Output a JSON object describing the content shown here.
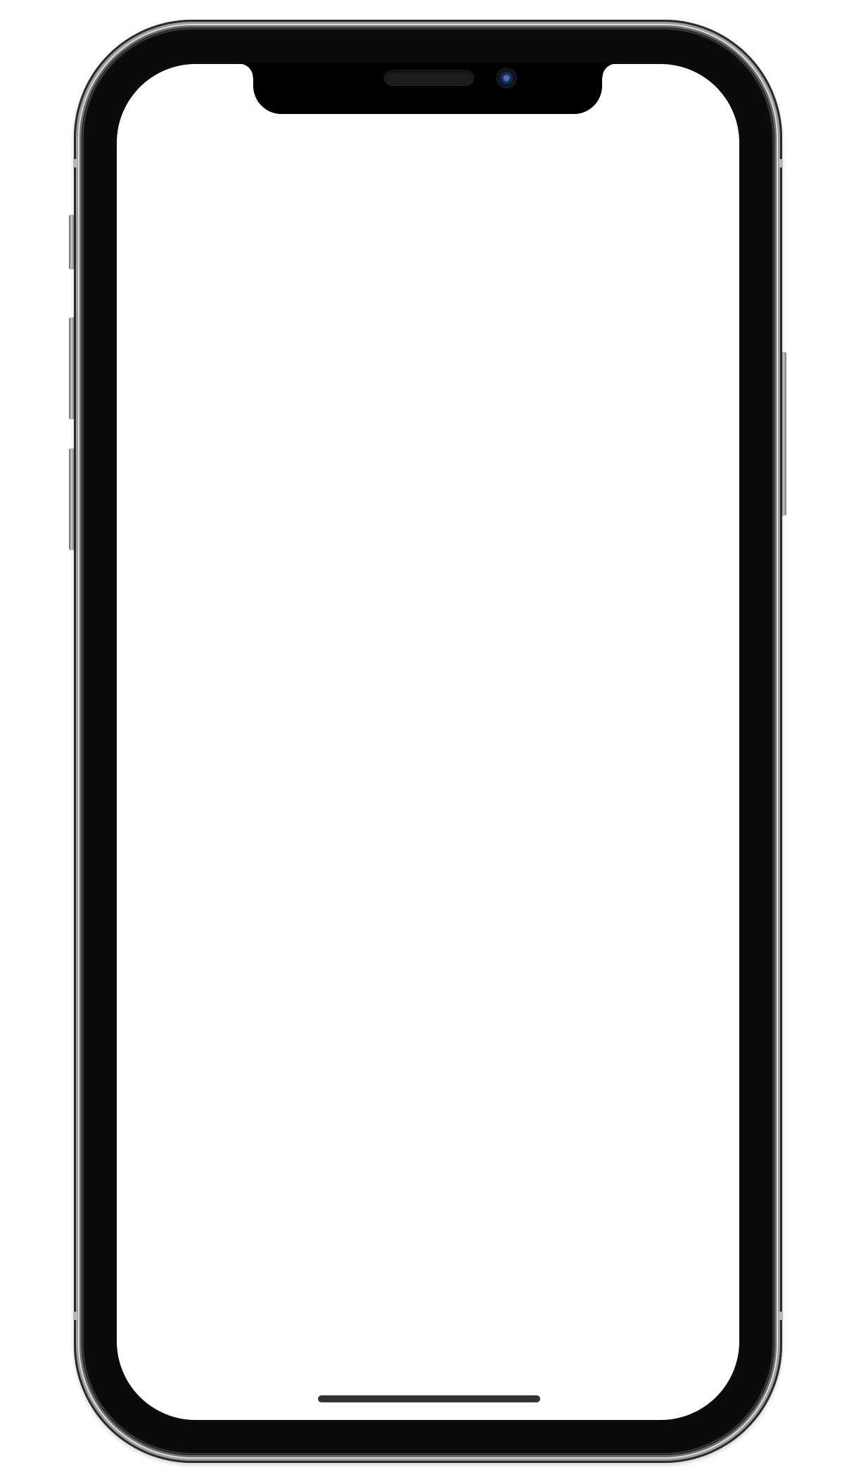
{
  "device": {
    "type": "smartphone frame",
    "frame_color": "#0b0b0b",
    "rim_color": "#c8c8c8",
    "screen_color": "#ffffff",
    "camera_icon": "front-camera-icon",
    "speaker_icon": "earpiece-speaker-icon",
    "home_indicator_color": "#333333"
  }
}
